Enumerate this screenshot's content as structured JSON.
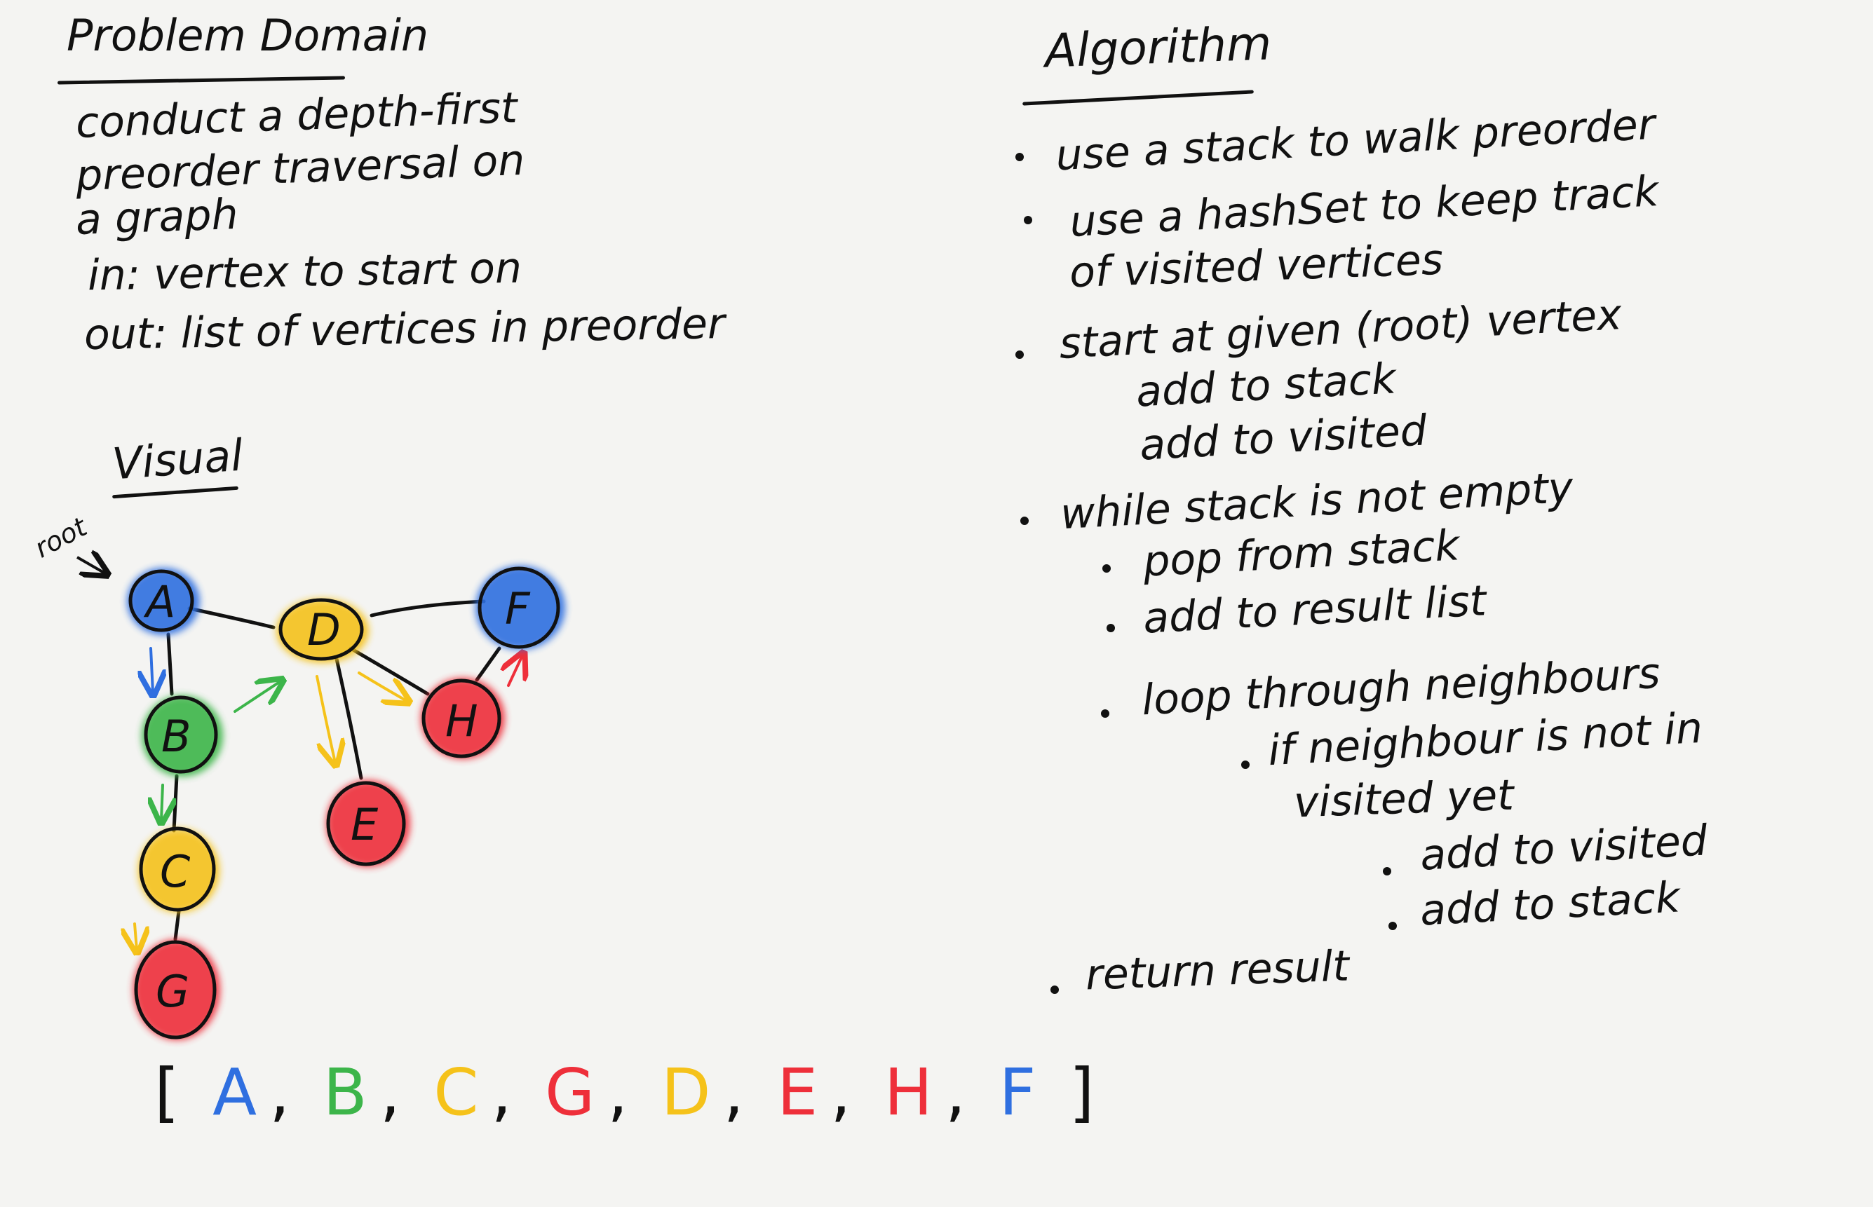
{
  "problem": {
    "title": "Problem Domain",
    "lines": [
      "conduct a depth-first",
      "preorder traversal on",
      "a graph",
      "in: vertex to start on",
      "out: list of vertices in preorder"
    ]
  },
  "visual": {
    "title": "Visual",
    "root_label": "root",
    "nodes": [
      {
        "id": "A",
        "color": "#2f6fe0"
      },
      {
        "id": "B",
        "color": "#3cb54a"
      },
      {
        "id": "C",
        "color": "#f5c21a"
      },
      {
        "id": "G",
        "color": "#ee2f3a"
      },
      {
        "id": "D",
        "color": "#f5c21a"
      },
      {
        "id": "E",
        "color": "#ee2f3a"
      },
      {
        "id": "H",
        "color": "#ee2f3a"
      },
      {
        "id": "F",
        "color": "#2f6fe0"
      }
    ]
  },
  "result": {
    "open": "[",
    "close": "]",
    "separator": ",",
    "items": [
      {
        "label": "A",
        "color": "#2f6fe0"
      },
      {
        "label": "B",
        "color": "#3cb54a"
      },
      {
        "label": "C",
        "color": "#f5c21a"
      },
      {
        "label": "G",
        "color": "#ee2f3a"
      },
      {
        "label": "D",
        "color": "#f5c21a"
      },
      {
        "label": "E",
        "color": "#ee2f3a"
      },
      {
        "label": "H",
        "color": "#ee2f3a"
      },
      {
        "label": "F",
        "color": "#2f6fe0"
      }
    ]
  },
  "algorithm": {
    "title": "Algorithm",
    "steps": [
      "use a stack to walk preorder",
      "use a hashSet to keep track",
      "of visited vertices",
      "start at given (root) vertex",
      "add to stack",
      "add to visited",
      "while stack is not empty",
      "pop from stack",
      "add to result list",
      "loop through neighbours",
      "if neighbour is not in",
      "visited yet",
      "add to visited",
      "add to stack",
      "return result"
    ]
  }
}
